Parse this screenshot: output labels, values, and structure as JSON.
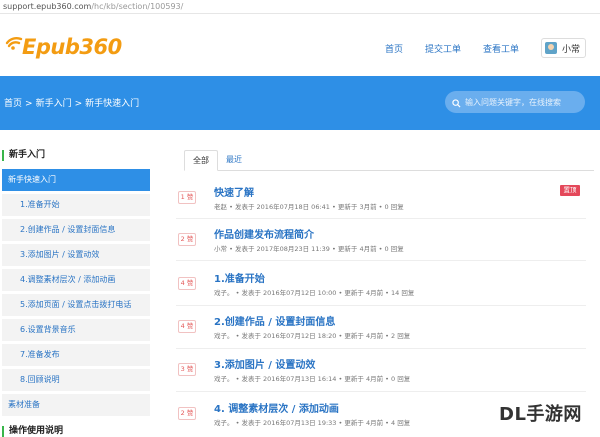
{
  "address_bar": {
    "host": "support.epub360.com",
    "path": "/hc/kb/section/100593/"
  },
  "header": {
    "logo_text": "Epub360",
    "nav": [
      "首页",
      "提交工单",
      "查看工单"
    ],
    "user_name": "小常"
  },
  "banner": {
    "breadcrumb": [
      "首页",
      "新手入门",
      "新手快速入门"
    ],
    "breadcrumb_sep": ">",
    "search_placeholder": "输入问题关键字，在线搜索"
  },
  "sidebar": {
    "section_title": "新手入门",
    "items": [
      {
        "label": "新手快速入门",
        "type": "category",
        "active": true
      },
      {
        "label": "1.准备开始",
        "type": "article"
      },
      {
        "label": "2.创建作品 / 设置封面信息",
        "type": "article"
      },
      {
        "label": "3.添加图片 / 设置动效",
        "type": "article"
      },
      {
        "label": "4.调整素材层次 / 添加动画",
        "type": "article"
      },
      {
        "label": "5.添加页面 / 设置点击拨打电话",
        "type": "article"
      },
      {
        "label": "6.设置背景音乐",
        "type": "article"
      },
      {
        "label": "7.准备发布",
        "type": "article"
      },
      {
        "label": "8.回顾说明",
        "type": "article"
      },
      {
        "label": "素材准备",
        "type": "category"
      }
    ],
    "section_title_2": "操作使用说明"
  },
  "main": {
    "tabs": [
      "全部",
      "最近"
    ],
    "active_tab": "全部",
    "posts": [
      {
        "likes": "1 赞",
        "title": "快速了解",
        "meta": "老赵 • 发表于 2016年07月18日 06:41 • 更新于 3月前 • 0 回复",
        "pinned": "置顶"
      },
      {
        "likes": "2 赞",
        "title": "作品创建发布流程简介",
        "meta": "小常 • 发表于 2017年08月23日 11:39 • 更新于 4月前 • 0 回复"
      },
      {
        "likes": "4 赞",
        "title": "1.准备开始",
        "meta": "戏子。 • 发表于 2016年07月12日 10:00 • 更新于 4月前 • 14 回复"
      },
      {
        "likes": "4 赞",
        "title": "2.创建作品 / 设置封面信息",
        "meta": "戏子。 • 发表于 2016年07月12日 18:20 • 更新于 4月前 • 2 回复"
      },
      {
        "likes": "3 赞",
        "title": "3.添加图片 / 设置动效",
        "meta": "戏子。 • 发表于 2016年07月13日 16:14 • 更新于 4月前 • 0 回复"
      },
      {
        "likes": "2 赞",
        "title": "4. 调整素材层次 / 添加动画",
        "meta": "戏子。 • 发表于 2016年07月13日 19:33 • 更新于 4月前 • 4 回复"
      }
    ]
  },
  "watermark": "DL手游网",
  "colors": {
    "brand_orange": "#f39c12",
    "primary_blue": "#2e8fe6",
    "link_blue": "#2a74c4",
    "accent_green": "#39b54a",
    "pin_red": "#e4485a"
  }
}
